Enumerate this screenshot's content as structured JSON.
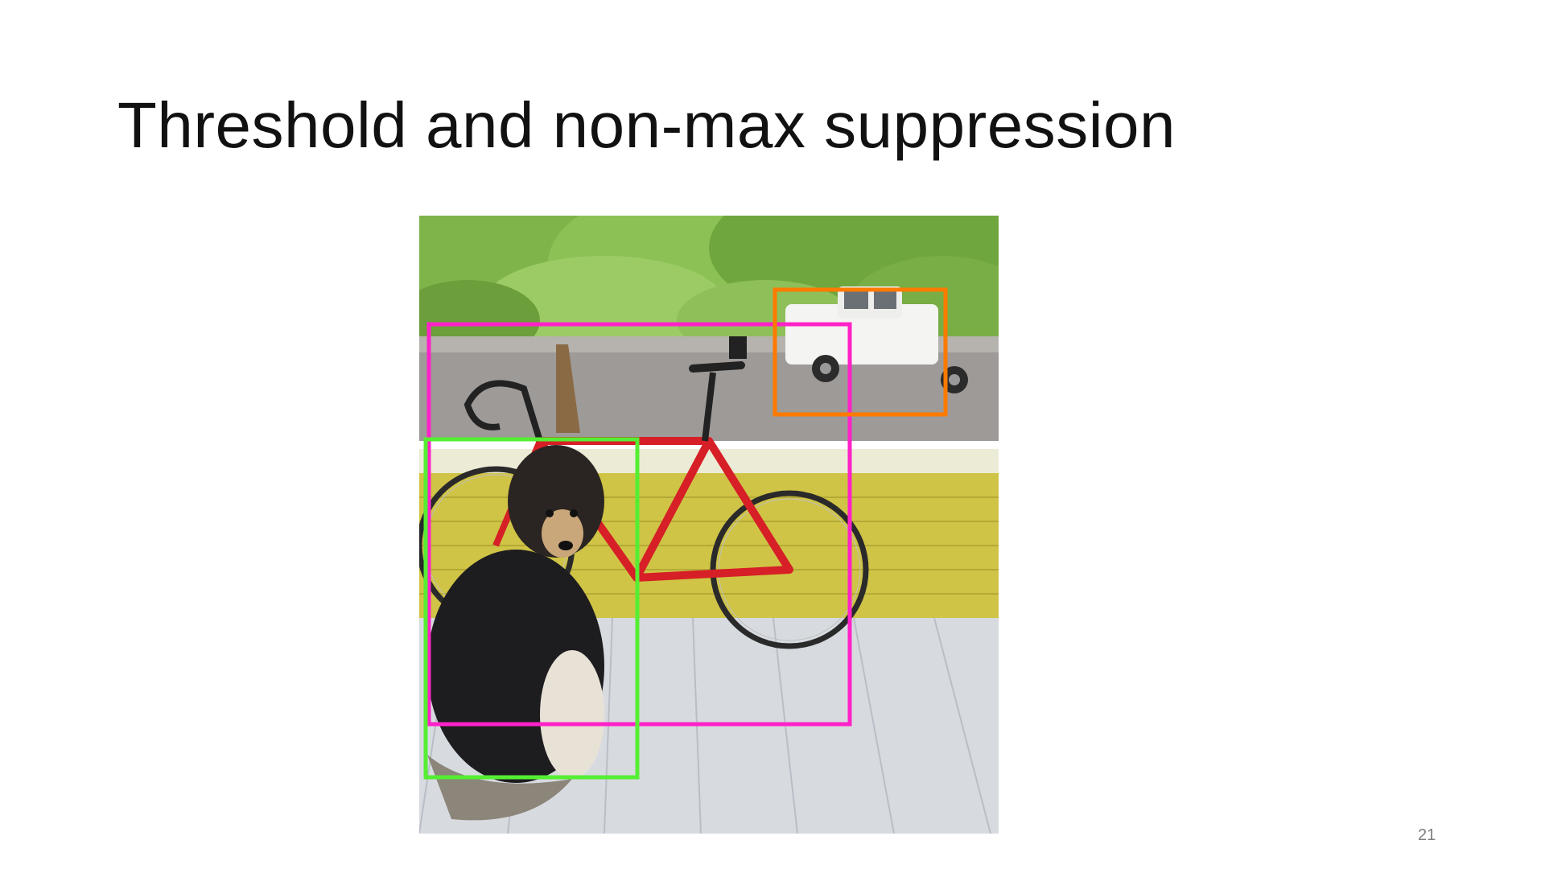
{
  "slide": {
    "title": "Threshold and non-max suppression",
    "page_number": "21"
  },
  "figure": {
    "description_icon": "photo-with-detections",
    "detections": [
      {
        "object": "bicycle",
        "box_color": "#ff22c8"
      },
      {
        "object": "dog",
        "box_color": "#55ee33"
      },
      {
        "object": "car",
        "box_color": "#ff7a00"
      }
    ]
  }
}
